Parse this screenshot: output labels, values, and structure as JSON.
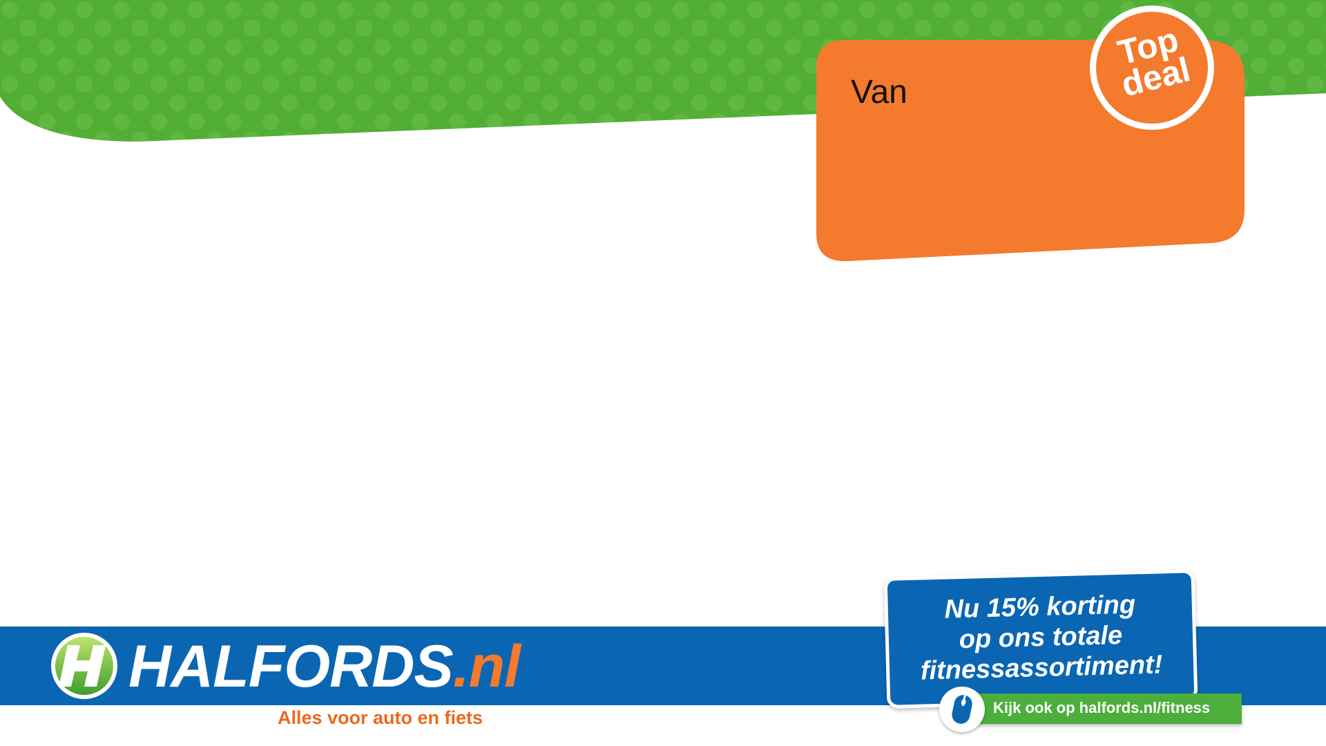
{
  "price_card": {
    "label": "Van",
    "badge_line1": "Top",
    "badge_line2": "deal",
    "badge_icon": "top-deal-sticker",
    "color": "#f47a2e"
  },
  "header": {
    "wave_color": "#52ae35",
    "dot_color": "#6cc04d"
  },
  "footer": {
    "band_color": "#0a66b3",
    "logo_icon": "halfords-h-logo",
    "brand_main": "HALFORDS",
    "brand_suffix": ".nl",
    "tagline": "Alles voor auto en fiets"
  },
  "promo": {
    "line1": "Nu 15% korting",
    "line2": "op ons totale",
    "line3": "fitnessassortiment!",
    "web_text": "Kijk ook op halfords.nl/fitness",
    "web_icon": "computer-mouse-icon",
    "strip_color": "#4caf3c"
  }
}
